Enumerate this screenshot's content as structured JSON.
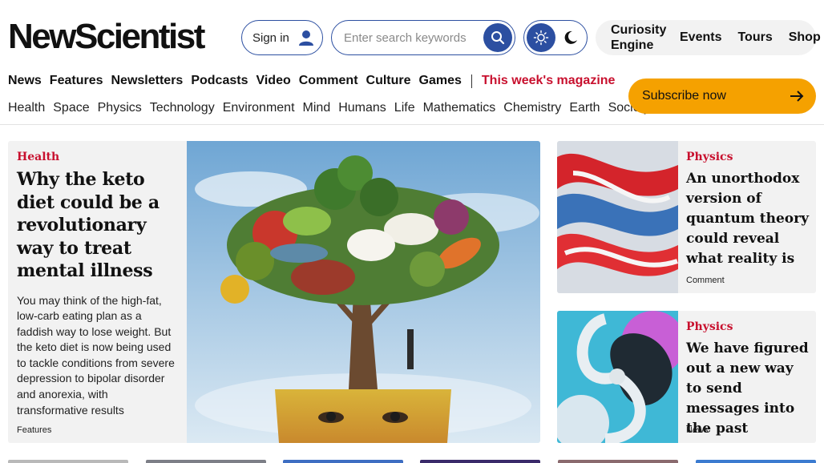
{
  "header": {
    "logo": "NewScientist",
    "signin_label": "Sign in",
    "search_placeholder": "Enter search keywords",
    "links": [
      "Curiosity Engine",
      "Events",
      "Tours",
      "Shop"
    ]
  },
  "nav": {
    "main": [
      "News",
      "Features",
      "Newsletters",
      "Podcasts",
      "Video",
      "Comment",
      "Culture",
      "Games"
    ],
    "magazine": "This week's magazine",
    "sub": [
      "Health",
      "Space",
      "Physics",
      "Technology",
      "Environment",
      "Mind",
      "Humans",
      "Life",
      "Mathematics",
      "Chemistry",
      "Earth",
      "Society"
    ],
    "subscribe": "Subscribe now"
  },
  "lead": {
    "category": "Health",
    "headline": "Why the keto diet could be a revolutionary way to treat mental illness",
    "dek": "You may think of the high-fat, low-carb eating plan as a faddish way to lose weight. But the keto diet is now being used to tackle conditions from severe depression to bipolar disorder and anorexia, with transformative results",
    "tag": "Features"
  },
  "side_stories": [
    {
      "category": "Physics",
      "headline": "An unorthodox version of quantum theory could reveal what reality is",
      "tag": "Comment"
    },
    {
      "category": "Physics",
      "headline": "We have figured out a new way to send messages into the past",
      "tag": "News"
    }
  ],
  "colors": {
    "accent_blue": "#2c4fa1",
    "accent_red": "#c8102e",
    "subscribe_orange": "#f5a100",
    "card_bg": "#f2f2f2"
  }
}
